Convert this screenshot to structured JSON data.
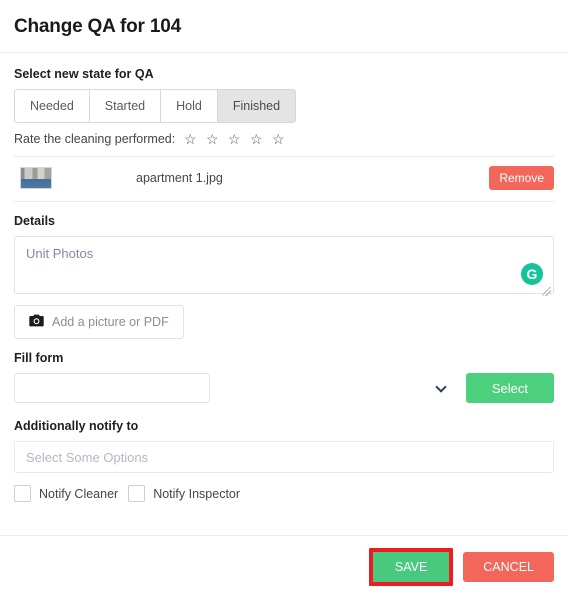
{
  "modal": {
    "title": "Change QA for 104"
  },
  "state_section": {
    "label": "Select new state for QA",
    "options": [
      {
        "label": "Needed",
        "active": false
      },
      {
        "label": "Started",
        "active": false
      },
      {
        "label": "Hold",
        "active": false
      },
      {
        "label": "Finished",
        "active": true
      }
    ],
    "selected": "Finished"
  },
  "rating": {
    "label": "Rate the cleaning performed:",
    "stars_total": 5,
    "stars_filled": 0,
    "star_glyph": "☆"
  },
  "attachment": {
    "filename": "apartment 1.jpg",
    "remove_label": "Remove",
    "thumbnail_icon": "photo-thumbnail"
  },
  "details": {
    "label": "Details",
    "value": "Unit Photos",
    "placeholder": "",
    "grammarly_badge": "G",
    "add_button_label": "Add a picture or PDF",
    "camera_icon": "camera-icon"
  },
  "fill_form": {
    "label": "Fill form",
    "selected_value": "",
    "options": [],
    "select_button_label": "Select"
  },
  "notify": {
    "label": "Additionally notify to",
    "placeholder": "Select Some Options",
    "value": "",
    "checkboxes": [
      {
        "label": "Notify Cleaner",
        "checked": false
      },
      {
        "label": "Notify Inspector",
        "checked": false
      }
    ]
  },
  "footer": {
    "save_label": "SAVE",
    "cancel_label": "CANCEL",
    "save_highlighted": true
  },
  "colors": {
    "save_green": "#48c97e",
    "select_green": "#4cd07d",
    "cancel_red": "#f2675a",
    "remove_red": "#f2675a",
    "highlight_red": "#ee1c22",
    "grammarly_green": "#15c39a",
    "active_tab_gray": "#e4e4e4"
  }
}
